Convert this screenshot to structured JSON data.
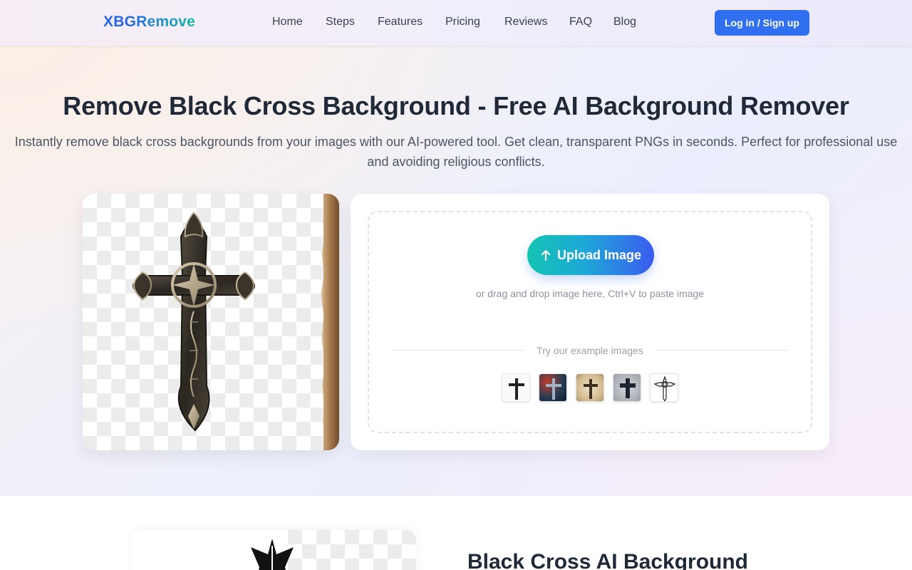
{
  "brand": {
    "logo": "XBGRemove"
  },
  "nav": {
    "links": [
      "Home",
      "Steps",
      "Features",
      "Pricing",
      "Reviews",
      "FAQ",
      "Blog"
    ],
    "login_label": "Log in / Sign up"
  },
  "hero": {
    "title": "Remove Black Cross Background - Free AI Background Remover",
    "subtitle": "Instantly remove black cross backgrounds from your images with our AI-powered tool. Get clean, transparent PNGs in seconds. Perfect for professional use and avoiding religious conflicts."
  },
  "uploader": {
    "button_label": "Upload Image",
    "button_icon": "arrow-up-icon",
    "hint": "or drag and drop image here, Ctrl+V to paste image",
    "examples_label": "Try our example images",
    "examples": [
      {
        "name": "example-plain-cross"
      },
      {
        "name": "example-galaxy-cross"
      },
      {
        "name": "example-parchment-cross"
      },
      {
        "name": "example-grunge-cross"
      },
      {
        "name": "example-sketch-cross"
      }
    ]
  },
  "section2": {
    "title": "Black Cross AI Background"
  },
  "colors": {
    "accent_blue": "#2f6ff0",
    "upload_gradient_start": "#14c4b3",
    "upload_gradient_end": "#3b5cf0",
    "text_dark": "#1f2937",
    "text_muted": "#4b5563"
  }
}
